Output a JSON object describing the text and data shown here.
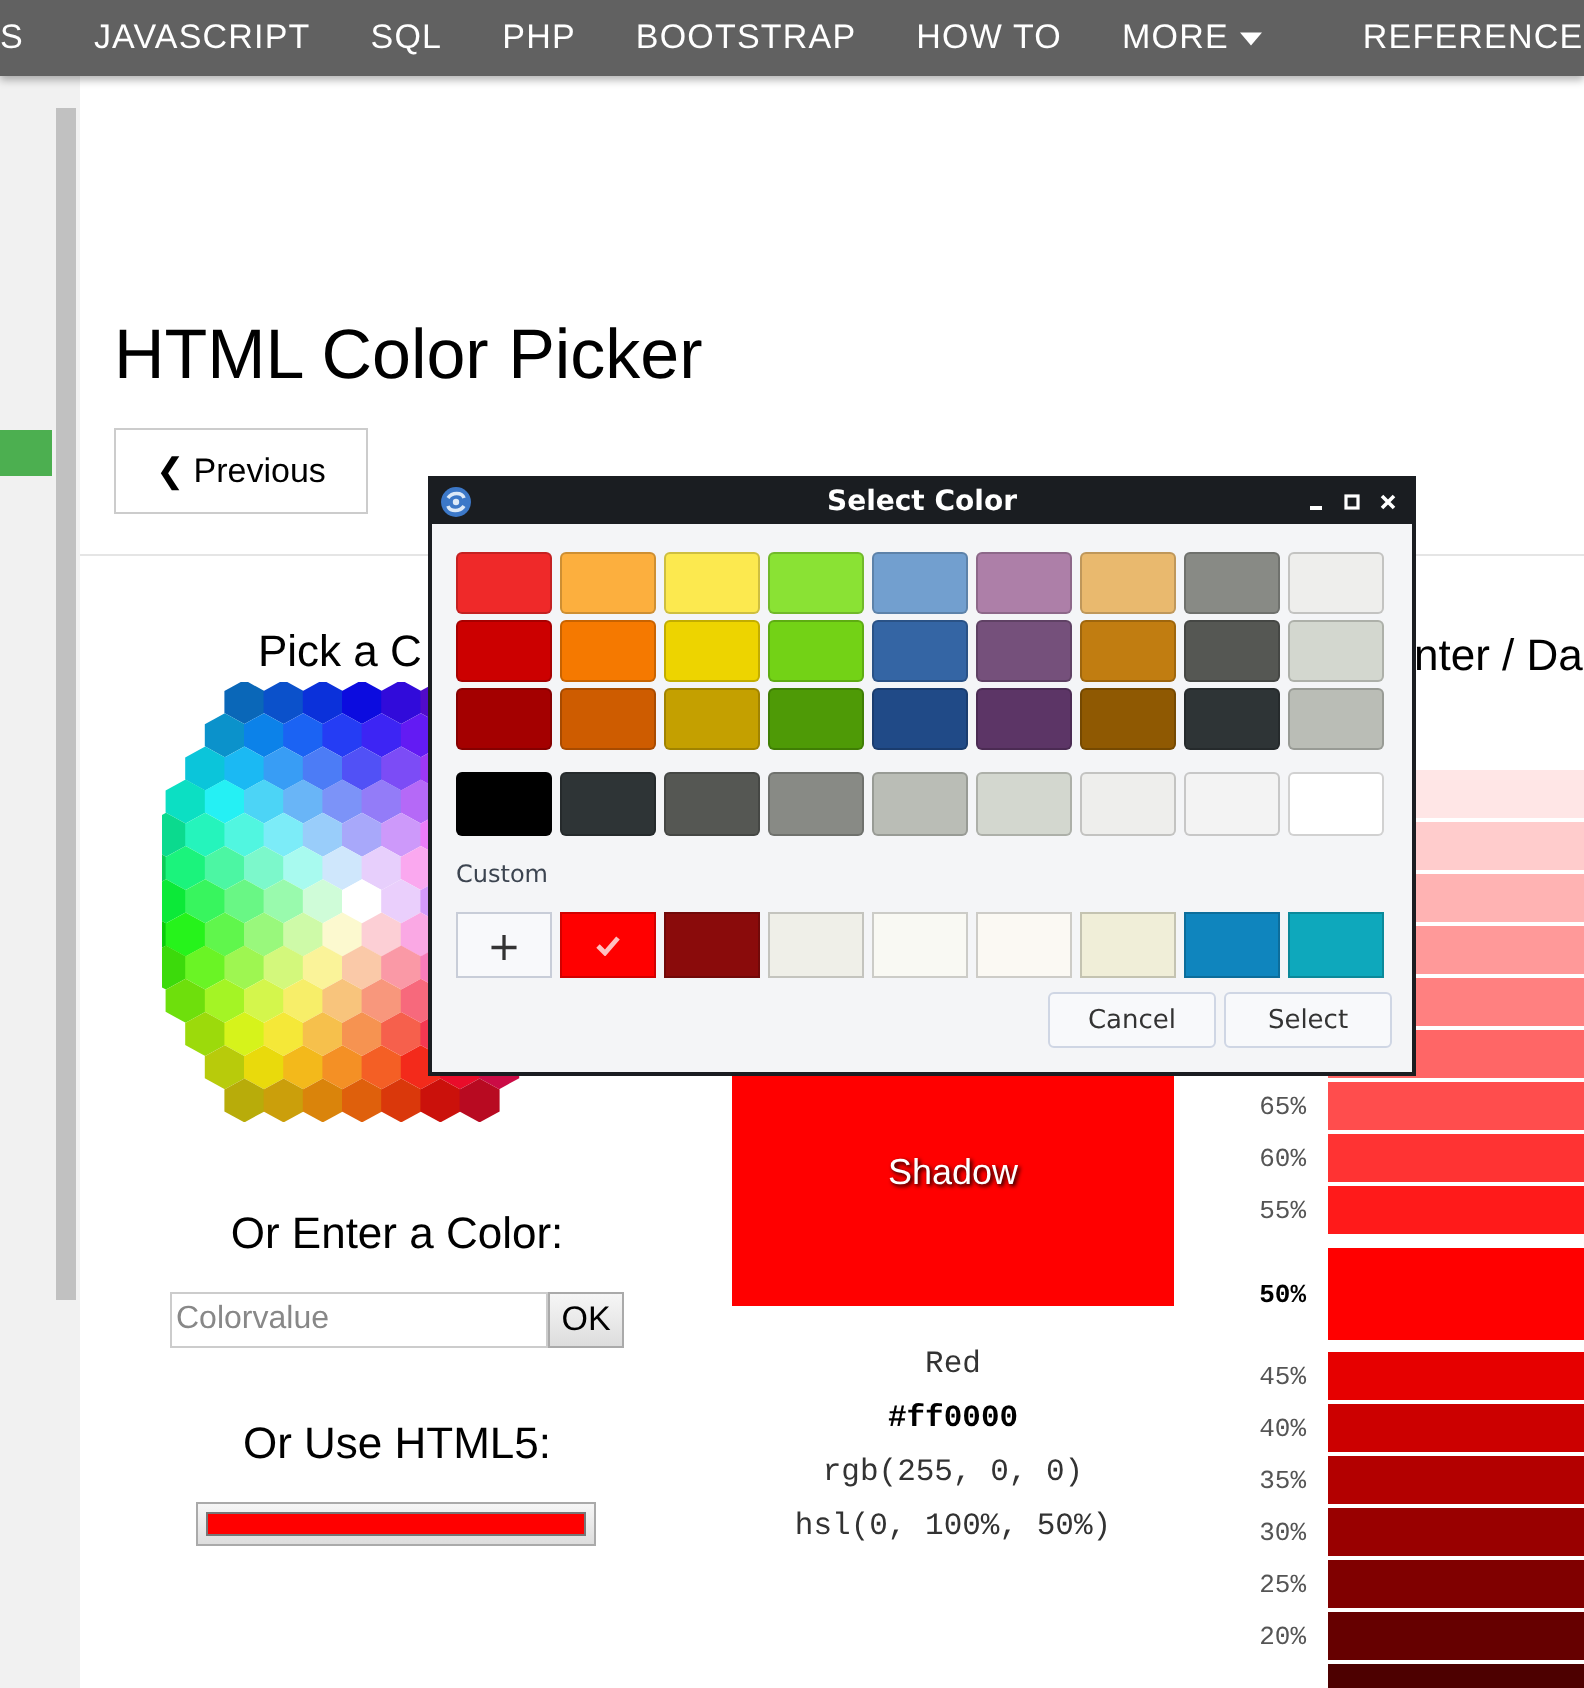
{
  "nav": {
    "items": [
      {
        "label": "S",
        "dropdown": false
      },
      {
        "label": "JAVASCRIPT",
        "dropdown": false
      },
      {
        "label": "SQL",
        "dropdown": false
      },
      {
        "label": "PHP",
        "dropdown": false
      },
      {
        "label": "BOOTSTRAP",
        "dropdown": false
      },
      {
        "label": "HOW TO",
        "dropdown": false
      },
      {
        "label": "MORE",
        "dropdown": true
      },
      {
        "label": "REFERENCE",
        "dropdown": false
      }
    ]
  },
  "title": "HTML Color Picker",
  "previous_button": "❮ Previous",
  "picker_column": {
    "heading": "Pick a C",
    "enter_heading": "Or Enter a Color:",
    "input_placeholder": "Colorvalue",
    "ok_button": "OK",
    "html5_heading": "Or Use HTML5:",
    "html5_picker": {
      "color": "#FF0000"
    }
  },
  "preview": {
    "texts": [
      "Shadow"
    ],
    "name": "Red",
    "hex": "#ff0000",
    "rgb": "rgb(255, 0, 0)",
    "hsl": "hsl(0, 100%, 50%)"
  },
  "shades": {
    "heading": "nter / Da",
    "rows": [
      {
        "color": "#ffe6e6",
        "selected": false
      },
      {
        "color": "#ffcccc",
        "selected": false
      },
      {
        "color": "#ffb3b3",
        "selected": false
      },
      {
        "color": "#ff9999",
        "selected": false
      },
      {
        "color": "#ff8080",
        "selected": false
      },
      {
        "color": "#ff6666",
        "selected": false
      },
      {
        "label": "65%",
        "color": "#ff4d4d",
        "selected": false
      },
      {
        "label": "60%",
        "color": "#ff3333",
        "selected": false
      },
      {
        "label": "55%",
        "color": "#ff1a1a",
        "selected": false
      },
      {
        "label": "50%",
        "color": "#FF0000",
        "selected": true
      },
      {
        "label": "45%",
        "color": "#e60000",
        "selected": false
      },
      {
        "label": "40%",
        "color": "#cc0000",
        "selected": false
      },
      {
        "label": "35%",
        "color": "#b30000",
        "selected": false
      },
      {
        "label": "30%",
        "color": "#990000",
        "selected": false
      },
      {
        "label": "25%",
        "color": "#800000",
        "selected": false
      },
      {
        "label": "20%",
        "color": "#660000",
        "selected": false
      },
      {
        "color": "#4d0000",
        "selected": false
      }
    ]
  },
  "dialog": {
    "title": "Select Color",
    "palette": [
      {
        "color": "#ef2929",
        "selected": false
      },
      {
        "color": "#fcaf3e",
        "selected": false
      },
      {
        "color": "#fce94f",
        "selected": false
      },
      {
        "color": "#8ae234",
        "selected": false
      },
      {
        "color": "#729fcf",
        "selected": false
      },
      {
        "color": "#ad7fa8",
        "selected": false
      },
      {
        "color": "#e9b96e",
        "selected": false
      },
      {
        "color": "#888a85",
        "selected": false
      },
      {
        "color": "#eeeeec",
        "selected": false
      },
      {
        "color": "#cc0000",
        "selected": false
      },
      {
        "color": "#f57900",
        "selected": false
      },
      {
        "color": "#edd400",
        "selected": false
      },
      {
        "color": "#73d216",
        "selected": false
      },
      {
        "color": "#3465a4",
        "selected": false
      },
      {
        "color": "#75507b",
        "selected": false
      },
      {
        "color": "#c17d11",
        "selected": false
      },
      {
        "color": "#555753",
        "selected": false
      },
      {
        "color": "#d3d7cf",
        "selected": false
      },
      {
        "color": "#a40000",
        "selected": false
      },
      {
        "color": "#ce5c00",
        "selected": false
      },
      {
        "color": "#c4a000",
        "selected": false
      },
      {
        "color": "#4e9a06",
        "selected": false
      },
      {
        "color": "#204a87",
        "selected": false
      },
      {
        "color": "#5c3566",
        "selected": false
      },
      {
        "color": "#8f5902",
        "selected": false
      },
      {
        "color": "#2e3436",
        "selected": false
      },
      {
        "color": "#babdb6",
        "selected": false
      }
    ],
    "grays": [
      {
        "color": "#000000",
        "selected": false
      },
      {
        "color": "#2e3436",
        "selected": false
      },
      {
        "color": "#555753",
        "selected": false
      },
      {
        "color": "#888a85",
        "selected": false
      },
      {
        "color": "#babdb6",
        "selected": false
      },
      {
        "color": "#d3d7cf",
        "selected": false
      },
      {
        "color": "#eeeeec",
        "selected": false
      },
      {
        "color": "#f3f3f3",
        "selected": false
      },
      {
        "color": "#ffffff",
        "selected": false
      }
    ],
    "custom_label": "Custom",
    "add_button": "+",
    "custom": [
      {
        "color": "#FF0000",
        "selected": true
      },
      {
        "color": "#8a0b0b",
        "selected": false
      },
      {
        "color": "#efefe8",
        "selected": false
      },
      {
        "color": "#f9f9f3",
        "selected": false
      },
      {
        "color": "#fbf9f3",
        "selected": false
      },
      {
        "color": "#f0eed8",
        "selected": false
      },
      {
        "color": "#0f85be",
        "selected": false
      },
      {
        "color": "#0ea8bc",
        "selected": false
      }
    ],
    "buttons": [
      "Cancel",
      "Select"
    ]
  }
}
